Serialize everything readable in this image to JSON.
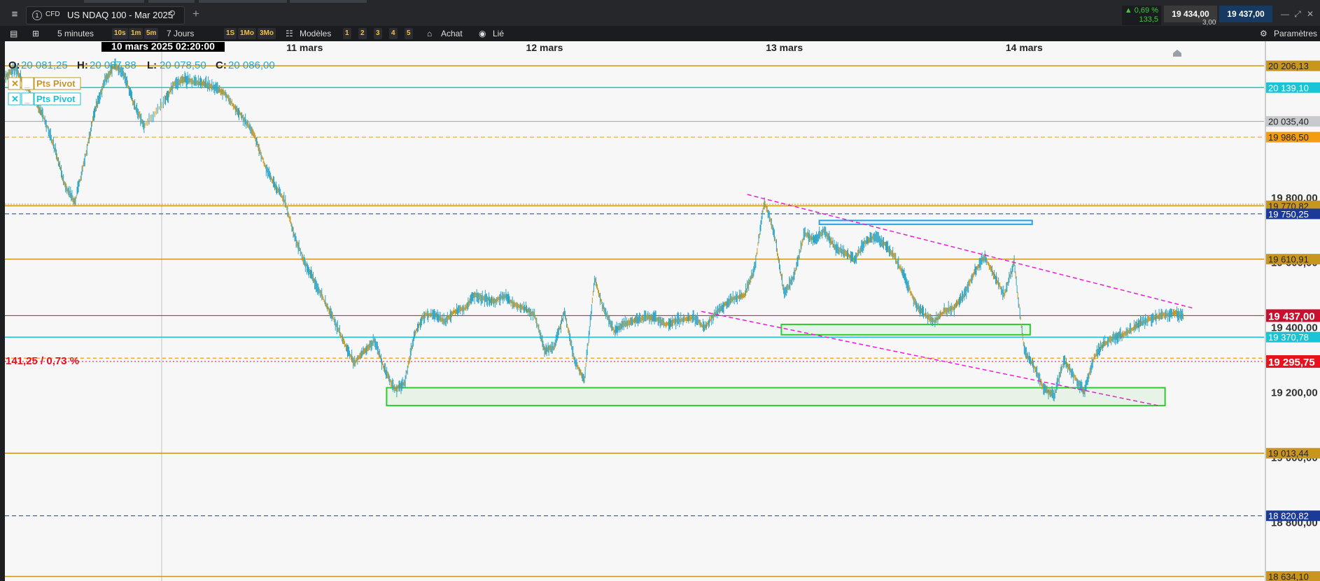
{
  "header": {
    "menu_icon": "hamburger-menu-icon",
    "tab_number": "1",
    "badge": "CFD",
    "instrument": "US NDAQ 100 - Mar 2025",
    "add_tab": "+",
    "change_pct": "▲ 0,69 %",
    "change_pts": "133,5",
    "bid": "19 434,00",
    "ask": "19 437,00",
    "spread": "3,00",
    "window_controls": [
      "—",
      "⤢",
      "⤡",
      "✕"
    ]
  },
  "toolbar": {
    "timeframe": "5 minutes",
    "quick_timeframes": [
      "10s",
      "1m",
      "5m"
    ],
    "range": "7 Jours",
    "ranges": [
      "1S",
      "1Mo",
      "3Mo"
    ],
    "models": "Modèles",
    "layouts": [
      "1",
      "2",
      "3",
      "4",
      "5"
    ],
    "achat": "Achat",
    "lie": "Lié",
    "settings": "Paramètres"
  },
  "chart_data": {
    "type": "line",
    "style": "ohlc-bars",
    "bar_color_up": "#2aa4c8",
    "bar_color_down": "#c8961e",
    "background": "#f7f7f7",
    "crosshair_label": "10 mars 2025 02:20:00",
    "ohlc": {
      "O": "20 081,25",
      "H": "20 087,88",
      "L": "20 078,50",
      "C": "20 086,00"
    },
    "x_labels": [
      {
        "label": "11 mars",
        "x": 30.0
      },
      {
        "label": "12 mars",
        "x": 54.0
      },
      {
        "label": "13 mars",
        "x": 78.0
      },
      {
        "label": "14 mars",
        "x": 102.0
      }
    ],
    "xlim": [
      0,
      126
    ],
    "ylim": [
      18620,
      20230
    ],
    "y_ticks": [
      "19 800,00",
      "19 600,00",
      "19 400,00",
      "19 200,00",
      "19 000,00",
      "18 800,00"
    ],
    "y_tick_values": [
      19800,
      19600,
      19400,
      19200,
      19000,
      18800
    ],
    "series": [
      {
        "values": [
          [
            0,
            20170
          ],
          [
            1,
            20200
          ],
          [
            2,
            20150
          ],
          [
            3,
            20100
          ],
          [
            4,
            20040
          ],
          [
            5,
            19950
          ],
          [
            6,
            19840
          ],
          [
            7,
            19785
          ],
          [
            8,
            19920
          ],
          [
            9,
            20070
          ],
          [
            10,
            20160
          ],
          [
            11,
            20210
          ],
          [
            12,
            20175
          ],
          [
            13,
            20080
          ],
          [
            14,
            20020
          ],
          [
            16,
            20100
          ],
          [
            17,
            20150
          ],
          [
            18,
            20165
          ],
          [
            19,
            20155
          ],
          [
            20,
            20150
          ],
          [
            21,
            20140
          ],
          [
            22,
            20120
          ],
          [
            23,
            20080
          ],
          [
            24,
            20040
          ],
          [
            25,
            19990
          ],
          [
            26,
            19900
          ],
          [
            27,
            19840
          ],
          [
            28,
            19790
          ],
          [
            29,
            19680
          ],
          [
            30,
            19600
          ],
          [
            31,
            19540
          ],
          [
            32,
            19480
          ],
          [
            33,
            19420
          ],
          [
            34,
            19350
          ],
          [
            35,
            19290
          ],
          [
            36,
            19330
          ],
          [
            37,
            19360
          ],
          [
            38,
            19270
          ],
          [
            39,
            19210
          ],
          [
            40,
            19230
          ],
          [
            41,
            19380
          ],
          [
            42,
            19440
          ],
          [
            43,
            19440
          ],
          [
            44,
            19420
          ],
          [
            45,
            19450
          ],
          [
            46,
            19460
          ],
          [
            47,
            19500
          ],
          [
            48,
            19490
          ],
          [
            49,
            19480
          ],
          [
            50,
            19500
          ],
          [
            51,
            19470
          ],
          [
            52,
            19460
          ],
          [
            53,
            19440
          ],
          [
            54,
            19330
          ],
          [
            55,
            19340
          ],
          [
            56,
            19450
          ],
          [
            57,
            19300
          ],
          [
            58,
            19240
          ],
          [
            59,
            19550
          ],
          [
            60,
            19450
          ],
          [
            61,
            19390
          ],
          [
            62,
            19410
          ],
          [
            63,
            19420
          ],
          [
            64,
            19430
          ],
          [
            65,
            19430
          ],
          [
            66,
            19410
          ],
          [
            67,
            19420
          ],
          [
            68,
            19425
          ],
          [
            69,
            19430
          ],
          [
            70,
            19400
          ],
          [
            71,
            19440
          ],
          [
            72,
            19470
          ],
          [
            73,
            19490
          ],
          [
            74,
            19500
          ],
          [
            75,
            19580
          ],
          [
            76,
            19790
          ],
          [
            77,
            19690
          ],
          [
            78,
            19500
          ],
          [
            79,
            19560
          ],
          [
            80,
            19690
          ],
          [
            81,
            19670
          ],
          [
            82,
            19700
          ],
          [
            83,
            19650
          ],
          [
            84,
            19630
          ],
          [
            85,
            19610
          ],
          [
            86,
            19660
          ],
          [
            87,
            19680
          ],
          [
            88,
            19660
          ],
          [
            89,
            19620
          ],
          [
            90,
            19560
          ],
          [
            91,
            19480
          ],
          [
            92,
            19440
          ],
          [
            93,
            19420
          ],
          [
            94,
            19450
          ],
          [
            95,
            19460
          ],
          [
            96,
            19500
          ],
          [
            97,
            19570
          ],
          [
            98,
            19620
          ],
          [
            99,
            19560
          ],
          [
            100,
            19500
          ],
          [
            101,
            19600
          ],
          [
            102,
            19330
          ],
          [
            103,
            19280
          ],
          [
            104,
            19210
          ],
          [
            105,
            19190
          ],
          [
            106,
            19300
          ],
          [
            107,
            19250
          ],
          [
            108,
            19200
          ],
          [
            109,
            19310
          ],
          [
            110,
            19350
          ],
          [
            111,
            19370
          ],
          [
            112,
            19380
          ],
          [
            113,
            19400
          ],
          [
            114,
            19420
          ],
          [
            115,
            19430
          ],
          [
            116,
            19440
          ],
          [
            117,
            19445
          ],
          [
            118,
            19437
          ]
        ]
      }
    ],
    "price_labels": [
      {
        "label": "20 206,13",
        "value": 20206,
        "color": "#c8961e"
      },
      {
        "label": "20 139,10",
        "value": 20139,
        "color": "#17c5d6"
      },
      {
        "label": "20 035,40",
        "value": 20035,
        "color": "#9aa0a6"
      },
      {
        "label": "19 986,50",
        "value": 19986.5,
        "color": "#f39c12"
      },
      {
        "label": "19 770,82",
        "value": 19775,
        "color": "#c8961e"
      },
      {
        "label": "19 750,25",
        "value": 19750.25,
        "color": "#1a3a9a"
      },
      {
        "label": "19 610,91",
        "value": 19610.91,
        "color": "#c8961e"
      },
      {
        "label": "19 437,00",
        "value": 19437,
        "color": "#c8102e"
      },
      {
        "label": "19 370,78",
        "value": 19370.78,
        "color": "#17c5d6"
      },
      {
        "label": "19 295,75",
        "value": 19295.75,
        "color": "#e8121e"
      },
      {
        "label": "19 013,44",
        "value": 19013.44,
        "color": "#c8961e"
      },
      {
        "label": "18 820,82",
        "value": 18820.82,
        "color": "#1a3a9a"
      },
      {
        "label": "18 634,10",
        "value": 18634.1,
        "color": "#c8961e"
      }
    ],
    "change_label": "141,25 / 0,73 %",
    "legend": [
      {
        "label": "Pts Pivot",
        "color": "#c8961e"
      },
      {
        "label": "Pts Pivot",
        "color": "#17c5d6"
      }
    ],
    "trend_lines": [
      {
        "x1": 74.3,
        "y1": 19810,
        "x2": 118.9,
        "y2": 19460,
        "color": "#e81ed4"
      },
      {
        "x1": 69.7,
        "y1": 19450,
        "x2": 115.4,
        "y2": 19160,
        "color": "#e81ed4"
      }
    ],
    "zones": [
      {
        "x1": 38.2,
        "y1": 19215,
        "x2": 116.1,
        "y2": 19160,
        "color": "#2ecc2e"
      },
      {
        "x1": 77.7,
        "y1": 19410,
        "x2": 102.6,
        "y2": 19378,
        "color": "#2ecc2e"
      },
      {
        "x1": 81.5,
        "y1": 19730,
        "x2": 102.8,
        "y2": 19718,
        "color": "#2aa4e0"
      }
    ]
  }
}
